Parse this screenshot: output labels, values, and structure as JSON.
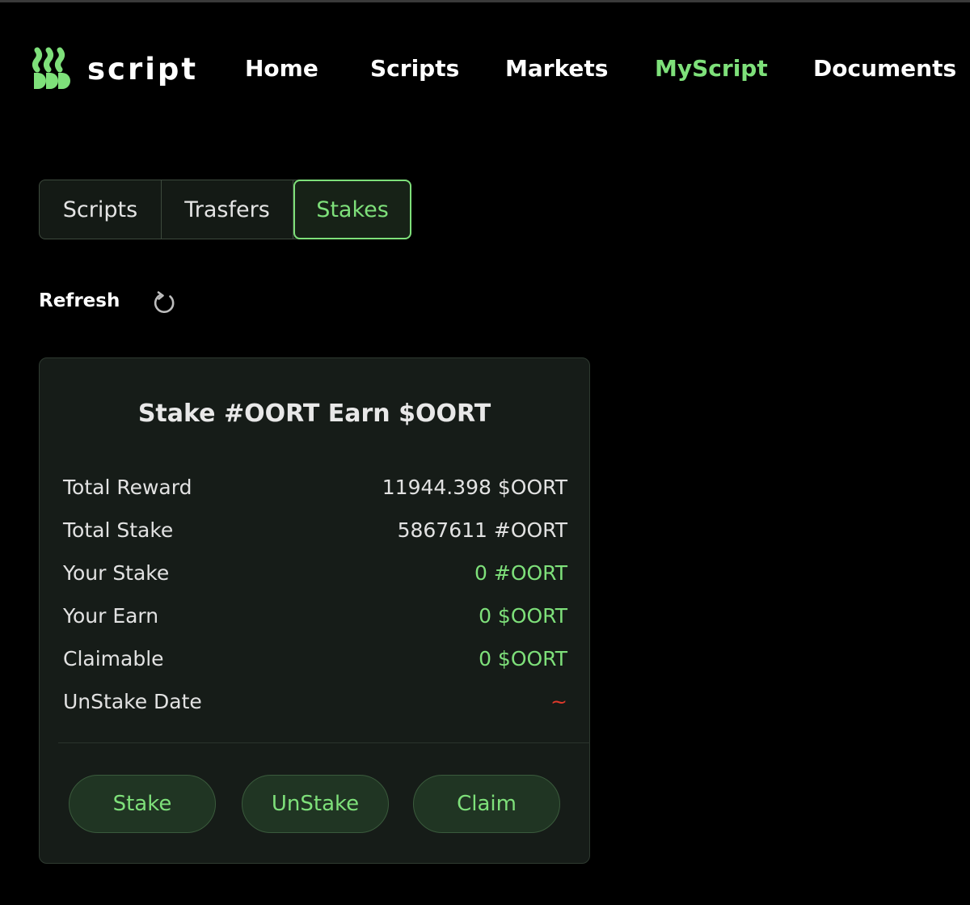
{
  "header": {
    "logo_text": "script",
    "nav": [
      {
        "label": "Home",
        "active": false
      },
      {
        "label": "Scripts",
        "active": false
      },
      {
        "label": "Markets",
        "active": false
      },
      {
        "label": "MyScript",
        "active": true
      },
      {
        "label": "Documents",
        "active": false
      }
    ]
  },
  "tabs": [
    {
      "label": "Scripts",
      "active": false
    },
    {
      "label": "Trasfers",
      "active": false
    },
    {
      "label": "Stakes",
      "active": true
    }
  ],
  "refresh": {
    "label": "Refresh",
    "icon": "refresh-icon"
  },
  "card": {
    "title": "Stake #OORT Earn $OORT",
    "rows": [
      {
        "label": "Total Reward",
        "value": "11944.398 $OORT",
        "tone": "default"
      },
      {
        "label": "Total Stake",
        "value": "5867611 #OORT",
        "tone": "default"
      },
      {
        "label": "Your Stake",
        "value": "0 #OORT",
        "tone": "green"
      },
      {
        "label": "Your Earn",
        "value": "0 $OORT",
        "tone": "green"
      },
      {
        "label": "Claimable",
        "value": "0 $OORT",
        "tone": "green"
      },
      {
        "label": "UnStake Date",
        "value": "~",
        "tone": "red"
      }
    ],
    "buttons": {
      "stake": "Stake",
      "unstake": "UnStake",
      "claim": "Claim"
    }
  },
  "colors": {
    "accent": "#7ee07a",
    "background": "#000000",
    "card": "#161c18",
    "button_bg": "#203523",
    "warning": "#e0392b"
  }
}
